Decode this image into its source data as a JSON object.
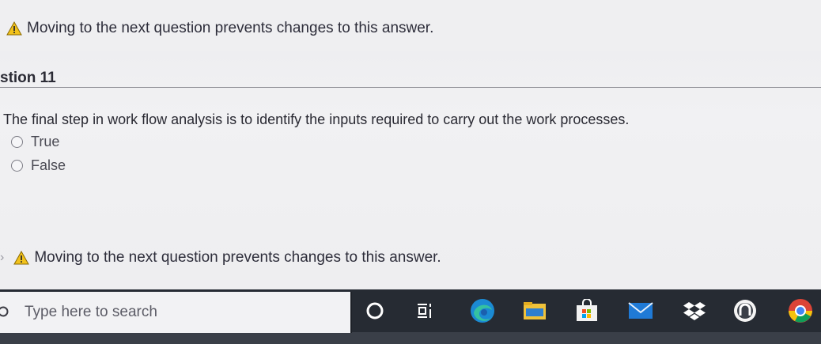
{
  "warnings": {
    "top": "Moving to the next question prevents changes to this answer.",
    "bottom": "Moving to the next question prevents changes to this answer."
  },
  "question": {
    "title": "stion 11",
    "text": "The final step in work flow analysis is to identify the inputs required to carry out the work processes.",
    "options": [
      {
        "label": "True",
        "selected": false
      },
      {
        "label": "False",
        "selected": false
      }
    ]
  },
  "taskbar": {
    "search_placeholder": "Type here to search",
    "icons": [
      "cortana-icon",
      "task-view-icon",
      "edge-icon",
      "file-explorer-icon",
      "store-icon",
      "mail-icon",
      "dropbox-icon",
      "app-icon",
      "chrome-icon"
    ]
  },
  "colors": {
    "warning_yellow": "#f2c21b",
    "taskbar_bg": "#262b33",
    "search_bg": "#f2f2f4"
  }
}
